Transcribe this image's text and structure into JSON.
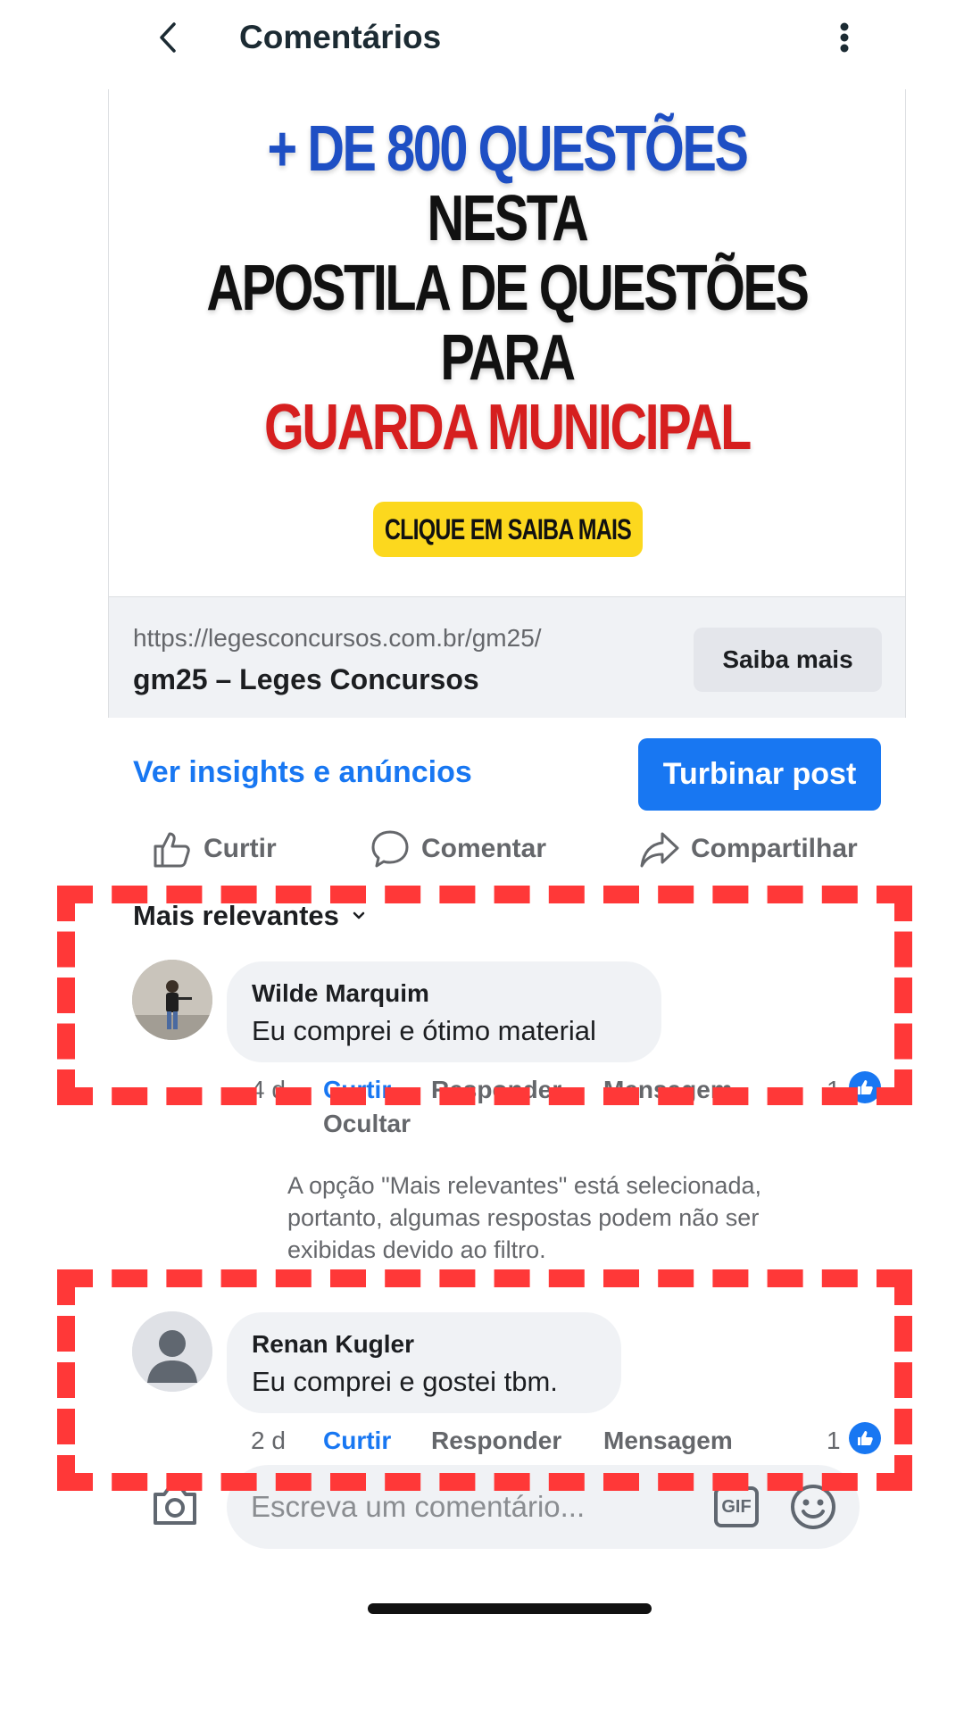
{
  "header": {
    "title": "Comentários"
  },
  "ad": {
    "headline": {
      "line1_prefix": "+ DE 800 QUESTÕES",
      "line1_suffix": "NESTA",
      "line2": "APOSTILA DE QUESTÕES PARA",
      "line3": "GUARDA MUNICIPAL"
    },
    "cta_badge": "CLIQUE EM SAIBA MAIS",
    "link": {
      "url": "https://legesconcursos.com.br/gm25/",
      "title": "gm25 – Leges Concursos",
      "button": "Saiba mais"
    }
  },
  "post_actions": {
    "insights": "Ver insights e anúncios",
    "boost": "Turbinar post",
    "like": "Curtir",
    "comment": "Comentar",
    "share": "Compartilhar"
  },
  "comments": {
    "sort_label": "Mais relevantes",
    "items": [
      {
        "name": "Wilde Marquim",
        "text": "Eu comprei e ótimo material",
        "time": "4 d",
        "like": "Curtir",
        "reply": "Responder",
        "message": "Mensagem",
        "hide": "Ocultar",
        "reactions": "1"
      },
      {
        "name": "Renan Kugler",
        "text": "Eu comprei e gostei tbm.",
        "time": "2 d",
        "like": "Curtir",
        "reply": "Responder",
        "message": "Mensagem",
        "reactions": "1"
      }
    ],
    "filter_note": "A opção \"Mais relevantes\" está selecionada, portanto, algumas respostas podem não ser exibidas devido ao filtro."
  },
  "composer": {
    "placeholder": "Escreva um comentário...",
    "gif_label": "GIF"
  },
  "colors": {
    "accent": "#1877f2",
    "annotation": "#ff3838",
    "headline_blue": "#1e4fc4",
    "headline_red": "#d61f1f",
    "cta_yellow": "#fcd81e"
  },
  "icons": [
    "back-icon",
    "more-vertical-icon",
    "like-icon",
    "comment-icon",
    "share-icon",
    "chevron-down-icon",
    "camera-icon",
    "gif-icon",
    "emoji-icon",
    "like-reaction-icon"
  ]
}
